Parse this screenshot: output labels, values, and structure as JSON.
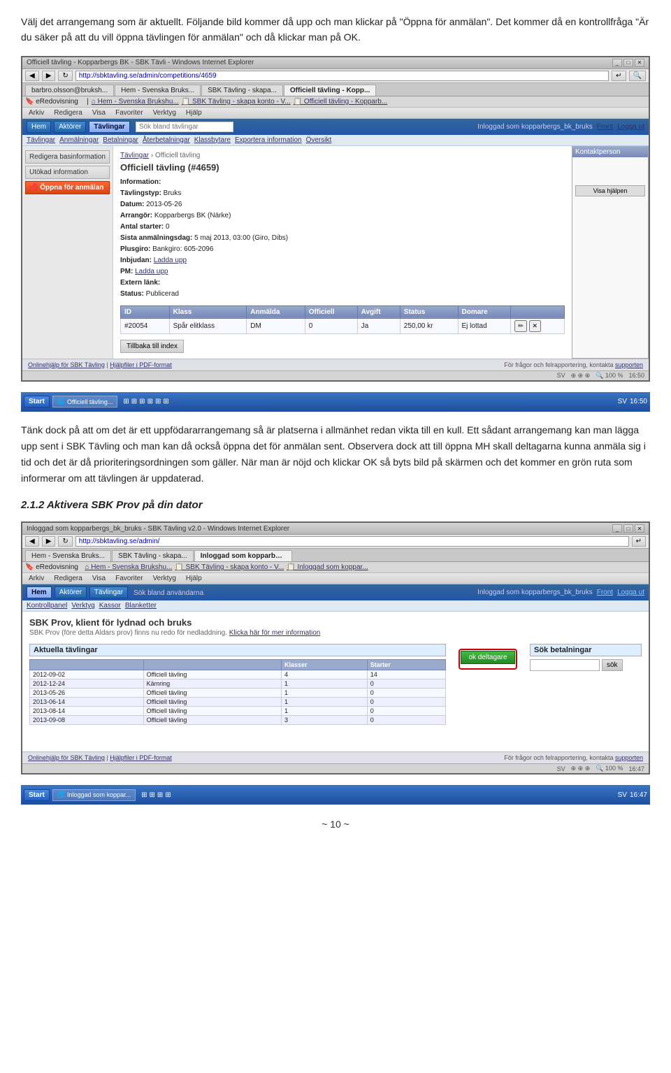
{
  "intro": {
    "para1": "Välj det arrangemang som är aktuellt. Följande bild kommer då upp och man klickar på \"Öppna för anmälan\". Det kommer då en kontrollfråga \"Är du säker på att du vill öppna tävlingen för anmälan\" och då klickar man på OK."
  },
  "browser1": {
    "titlebar": "Officiell tävling - Kopparbergs BK - SBK Tävli - Windows Internet Explorer",
    "address": "http://sbktavling.se/admin/competitions/4659",
    "tabs": [
      {
        "label": "barbro.olsson@bruks...",
        "active": false
      },
      {
        "label": "Hem - Svenska Bruks...",
        "active": false
      },
      {
        "label": "SBK Tävling - skapa konto - V...",
        "active": false
      },
      {
        "label": "Officiell tävling - Kopparb...",
        "active": true
      }
    ],
    "menubar": [
      "Arkiv",
      "Redigera",
      "Visa",
      "Favoriter",
      "Verktyg",
      "Hjälp"
    ],
    "topnav": {
      "links": [
        "Hem",
        "Aktörer",
        "Tävlingar"
      ],
      "search_placeholder": "Sök bland tävlingar",
      "logged_in": "Inloggad som kopparbergs_bk_bruks",
      "right_links": [
        "Front",
        "Logga ut"
      ]
    },
    "subnav": [
      "Tävlingar",
      "Anmälningar",
      "Betalningar",
      "Återbetalningar",
      "Klassbytare",
      "Exportera information",
      "Översikt"
    ],
    "sidebar_btns": [
      "Redigera basinformation",
      "Utökad information",
      "Öppna för anmälan"
    ],
    "breadcrumb": "Tävlingar › Officiell tävling",
    "content_title": "Officiell tävling (#4659)",
    "info_label": "Information:",
    "info_rows": [
      {
        "label": "Tävlingstyp:",
        "value": "Bruks"
      },
      {
        "label": "Datum:",
        "value": "2013-05-26"
      },
      {
        "label": "Arrangör:",
        "value": "Kopparbergs BK (Närke)"
      },
      {
        "label": "Antal starter:",
        "value": "0"
      },
      {
        "label": "Sista anmälningsdag:",
        "value": "5 maj 2013, 03:00 (Giro, Dibs)"
      },
      {
        "label": "Plusgiro:",
        "value": "Bankgiro: 605-2096"
      },
      {
        "label": "Inbjudan:",
        "value": "Ladda upp"
      },
      {
        "label": "PM:",
        "value": "Ladda upp"
      },
      {
        "label": "Extern länk:",
        "value": ""
      },
      {
        "label": "Status:",
        "value": "Publicerad"
      }
    ],
    "table_headers": [
      "ID",
      "Klass",
      "Anmälda",
      "Officiell",
      "Avgift",
      "Status",
      "Domare",
      ""
    ],
    "table_rows": [
      {
        "id": "#20054",
        "klass": "Spår elitklass",
        "anmalda": "DM",
        "officiell": "0",
        "avgift": "Ja",
        "status": "250,00 kr",
        "domare": "Ej lottad",
        "actions": ""
      }
    ],
    "back_btn": "Tillbaka till index",
    "footer_left": "Onlinehjälp för SBK Tävling | Hjälpfiler i PDF-format",
    "footer_right": "För frågor och felrapportering, kontakta supporten",
    "statusbar_left": "SV",
    "statusbar_zoom": "100 %",
    "statusbar_time": "16:50"
  },
  "taskbar1": {
    "start": "Start",
    "items": [
      "SV",
      "☷",
      "☷",
      "☷",
      "☷",
      "☷",
      "☷",
      "☷",
      "☷"
    ],
    "time": "SV ☷ 16:50"
  },
  "body_text": {
    "para1": "Tänk dock på att om det är ett uppfödararrangemang så är platserna i allmänhet redan vikta till en kull. Ett sådant arrangemang kan man lägga upp sent i SBK Tävling och man kan då också öppna det för anmälan sent. Observera dock att till öppna MH skall deltagarna kunna anmäla sig i tid och det är då prioriteringsordningen som gäller. När man är nöjd och klickar OK så byts bild på skärmen och det kommer en grön ruta som informerar om att tävlingen är uppdaterad."
  },
  "section_heading": "2.1.2 Aktivera SBK Prov på din dator",
  "browser2": {
    "titlebar": "Inloggad som kopparbergs_bk_bruks - SBK Tävling v2.0 - Windows Internet Explorer",
    "address": "http://sbktavling.se/admin/",
    "tabs": [
      {
        "label": "Hem - Svenska Bruks...",
        "active": false
      },
      {
        "label": "SBK Tävling - skapa konto - V...",
        "active": false
      },
      {
        "label": "Inloggad som kopparber...",
        "active": true
      }
    ],
    "menubar": [
      "Arkiv",
      "Redigera",
      "Visa",
      "Favoriter",
      "Verktyg",
      "Hjälp"
    ],
    "topnav": {
      "links": [
        "Hem",
        "Aktörer",
        "Tävlingar"
      ],
      "search_label": "Sök bland användarna",
      "logged_in": "Inloggad som kopparbergs_bk_bruks",
      "right_links": [
        "Front",
        "Logga ut"
      ]
    },
    "subnav": [
      "Kontrollpanel",
      "Verktyg",
      "Kassor",
      "Blanketter"
    ],
    "app2_title": "SBK Prov, klient för lydnad och bruks",
    "app2_subtitle": "SBK Prov (före detta Aldars prov) finns nu redo för nedladdning. Klicka här för mer information",
    "aktuella_label": "Aktuella tävlingar",
    "table2_headers": [
      "",
      "Klaseer",
      "Starter"
    ],
    "table2_rows": [
      {
        "date": "2012-09-02",
        "name": "Officiell tävling",
        "klasser": "4",
        "starter": "14"
      },
      {
        "date": "2012-12-24",
        "name": "Kämring",
        "klasser": "1",
        "starter": "0"
      },
      {
        "date": "2013-05-26",
        "name": "Officiell tävling",
        "klasser": "1",
        "starter": "0"
      },
      {
        "date": "2013-06-14",
        "name": "Officiell tävling",
        "klasser": "1",
        "starter": "0"
      },
      {
        "date": "2013-08-14",
        "name": "Officiell tävling",
        "klasser": "1",
        "starter": "0"
      },
      {
        "date": "2013-09-08",
        "name": "Officiell tävling",
        "klasser": "3",
        "starter": "0"
      }
    ],
    "ok_btn": "ok deltagare",
    "sok_label": "Sök betalningar",
    "sok_btn": "sök",
    "footer_left": "Onlinehjälp för SBK Tävling | Hjälpfiler i PDF-format",
    "footer_right": "För frågor och felrapportering, kontakta supporten",
    "statusbar_zoom": "100 %",
    "statusbar_time": "16:47"
  },
  "taskbar2": {
    "time": "SV ☷ 16:47"
  },
  "page_number": "~ 10 ~"
}
